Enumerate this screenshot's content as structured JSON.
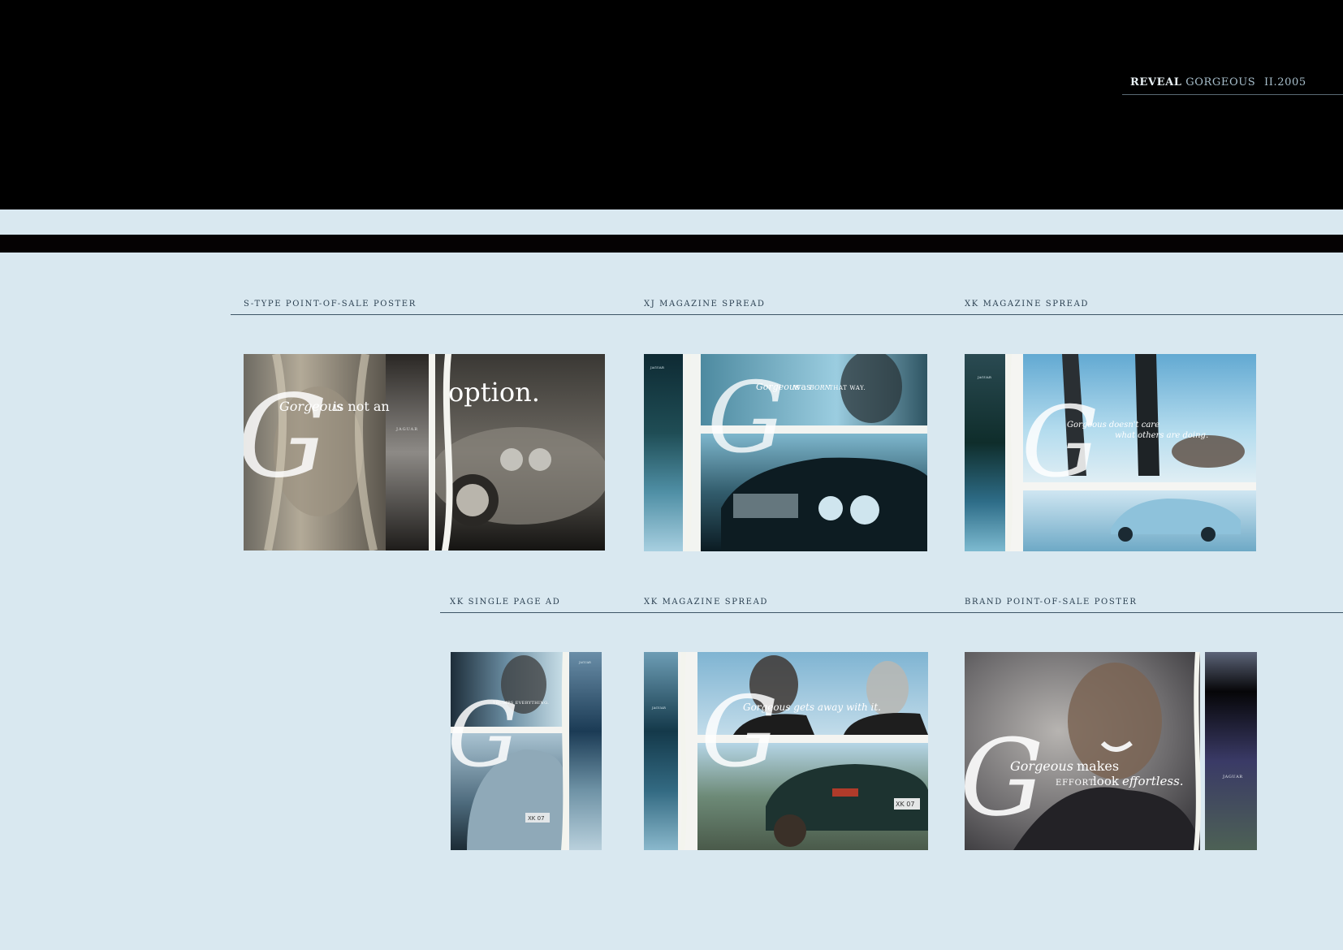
{
  "header": {
    "word1": "REVEAL",
    "word2": "GORGEOUS",
    "issue": "II.2005"
  },
  "sections": [
    {
      "label": "S-TYPE POINT-OF-SALE POSTER"
    },
    {
      "label": "XJ MAGAZINE SPREAD"
    },
    {
      "label": "XK MAGAZINE SPREAD"
    },
    {
      "label": "XK SINGLE PAGE AD"
    },
    {
      "label": "XK MAGAZINE SPREAD"
    },
    {
      "label": "BRAND POINT-OF-SALE POSTER"
    }
  ],
  "panels": {
    "stype": {
      "headline_a": "Gorgeous",
      "headline_b": "is not an",
      "headline_c": "option.",
      "brand": "JAGUAR",
      "initial": "G"
    },
    "xj": {
      "headline_a": "Gorgeous",
      "headline_b": "was",
      "headline_c": "BORN",
      "headline_d": "THAT WAY.",
      "brand": "JAGUAR",
      "initial": "G"
    },
    "xk1": {
      "line1": "Gorgeous doesn't care",
      "line2": "what others are doing.",
      "brand": "JAGUAR",
      "initial": "G"
    },
    "xksingle": {
      "line1": "TRUMPS EVERYTHING.",
      "brand": "JAGUAR",
      "initial": "G",
      "plate": "XK 07"
    },
    "xk2": {
      "line1": "Gorgeous gets away with it.",
      "brand": "JAGUAR",
      "initial": "G",
      "plate": "XK 07"
    },
    "brand": {
      "line1a": "Gorgeous",
      "line1b": "makes",
      "line2a": "EFFORT",
      "line2b": "look",
      "line2c": "effortless.",
      "brand": "JAGUAR",
      "initial": "G"
    }
  }
}
